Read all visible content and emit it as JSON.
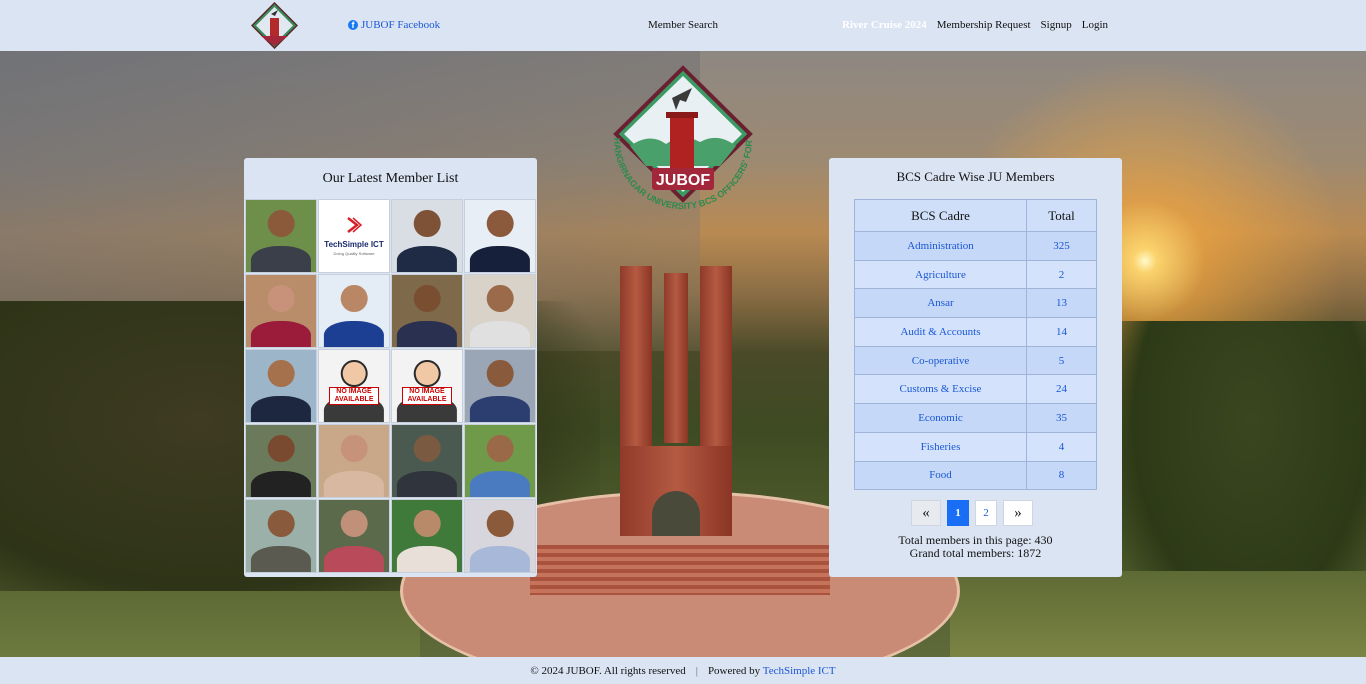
{
  "header": {
    "facebook_label": "JUBOF Facebook",
    "member_search": "Member Search",
    "river_cruise": "River Cruise 2024",
    "membership_request": "Membership Request",
    "signup": "Signup",
    "login": "Login"
  },
  "logo": {
    "text": "JUBOF",
    "ring_text": "JAHANGIRNAGAR UNIVERSITY BCS OFFICERS' FORUM"
  },
  "latest_members": {
    "title": "Our Latest Member List",
    "photos": [
      {
        "kind": "photo",
        "bg": "#6d8f4a",
        "skin": "#8a5a3a",
        "cloth": "#3a3f4a"
      },
      {
        "kind": "brand",
        "name": "TechSimple ICT",
        "tagline": "Doing Quality Software"
      },
      {
        "kind": "photo",
        "bg": "#d9dde4",
        "skin": "#7d5236",
        "cloth": "#1f2a44"
      },
      {
        "kind": "photo",
        "bg": "#e8eef5",
        "skin": "#8b5a3c",
        "cloth": "#16203a"
      },
      {
        "kind": "photo",
        "bg": "#b98c6a",
        "skin": "#c8927a",
        "cloth": "#9a1c3a"
      },
      {
        "kind": "photo",
        "bg": "#e4ecf5",
        "skin": "#b98765",
        "cloth": "#1c3f94"
      },
      {
        "kind": "photo",
        "bg": "#7e6a4a",
        "skin": "#7a4e30",
        "cloth": "#2a3050"
      },
      {
        "kind": "photo",
        "bg": "#d8d2c8",
        "skin": "#9a6a4a",
        "cloth": "#e0e0e0"
      },
      {
        "kind": "photo",
        "bg": "#9db5c8",
        "skin": "#a5704c",
        "cloth": "#1d2740"
      },
      {
        "kind": "noimage",
        "label": "NO IMAGE AVAILABLE"
      },
      {
        "kind": "noimage",
        "label": "NO IMAGE AVAILABLE"
      },
      {
        "kind": "photo",
        "bg": "#9aa6b6",
        "skin": "#8a5a3c",
        "cloth": "#2c3e70"
      },
      {
        "kind": "photo",
        "bg": "#6a7a5a",
        "skin": "#7a4a30",
        "cloth": "#222"
      },
      {
        "kind": "photo",
        "bg": "#c9a88a",
        "skin": "#c7927a",
        "cloth": "#d8b8a0"
      },
      {
        "kind": "photo",
        "bg": "#4a5a50",
        "skin": "#7a5a40",
        "cloth": "#30343c"
      },
      {
        "kind": "photo",
        "bg": "#6f9a4a",
        "skin": "#9a6a48",
        "cloth": "#4a7ac0"
      },
      {
        "kind": "photo",
        "bg": "#9ab0a8",
        "skin": "#8a5a3c",
        "cloth": "#5a5a50"
      },
      {
        "kind": "photo",
        "bg": "#5a6a4a",
        "skin": "#c09078",
        "cloth": "#b84a5a"
      },
      {
        "kind": "photo",
        "bg": "#3f7a3a",
        "skin": "#b98a6a",
        "cloth": "#e8e0d8"
      },
      {
        "kind": "photo",
        "bg": "#d6d6dc",
        "skin": "#8a5a3a",
        "cloth": "#a8b8d8"
      }
    ]
  },
  "cadre": {
    "title": "BCS Cadre Wise JU Members",
    "columns": [
      "BCS Cadre",
      "Total"
    ],
    "rows": [
      [
        "Administration",
        "325"
      ],
      [
        "Agriculture",
        "2"
      ],
      [
        "Ansar",
        "13"
      ],
      [
        "Audit & Accounts",
        "14"
      ],
      [
        "Co-operative",
        "5"
      ],
      [
        "Customs & Excise",
        "24"
      ],
      [
        "Economic",
        "35"
      ],
      [
        "Fisheries",
        "4"
      ],
      [
        "Food",
        "8"
      ]
    ],
    "pagination": {
      "prev": "«",
      "pages": [
        "1",
        "2"
      ],
      "current": "1",
      "next": "»"
    },
    "page_total": "Total members in this page: 430",
    "grand_total": "Grand total members: 1872"
  },
  "footer": {
    "copyright": "© 2024 JUBOF. All rights reserved",
    "separator": "|",
    "powered_by": "Powered by",
    "company": "TechSimple ICT"
  },
  "colors": {
    "topbar": "#dbe4f3",
    "link": "#1a57d6",
    "active_page": "#1a6df5",
    "logo_red": "#a2273a",
    "logo_green": "#2e8a4e"
  }
}
